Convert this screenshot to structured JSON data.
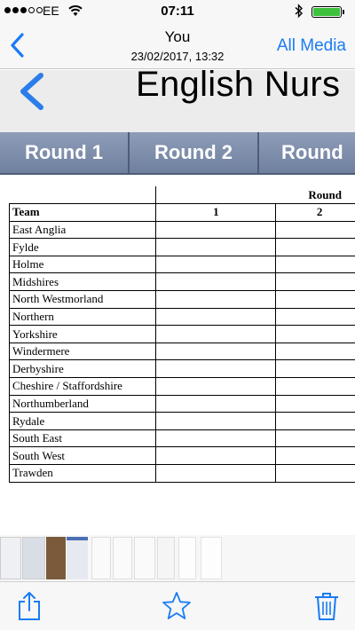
{
  "status_bar": {
    "carrier": "EE",
    "time": "07:11",
    "battery_color": "#3dc23d"
  },
  "nav": {
    "title": "You",
    "subtitle": "23/02/2017, 13:32",
    "right_label": "All Media",
    "accent_color": "#1a7cf4"
  },
  "document": {
    "title": "English Nurs",
    "tabs": [
      "Round 1",
      "Round 2",
      "Round"
    ],
    "table": {
      "group_header": "Round",
      "team_header": "Team",
      "columns": [
        "1",
        "2"
      ],
      "teams": [
        "East Anglia",
        "Fylde",
        "Holme",
        "Midshires",
        "North Westmorland",
        "Northern",
        "Yorkshire",
        "Windermere",
        "Derbyshire",
        "Cheshire / Staffordshire",
        "Northumberland",
        "Rydale",
        "South East",
        "South West",
        "Trawden"
      ]
    }
  },
  "toolbar": {
    "icons": [
      "share-icon",
      "star-icon",
      "trash-icon"
    ]
  }
}
